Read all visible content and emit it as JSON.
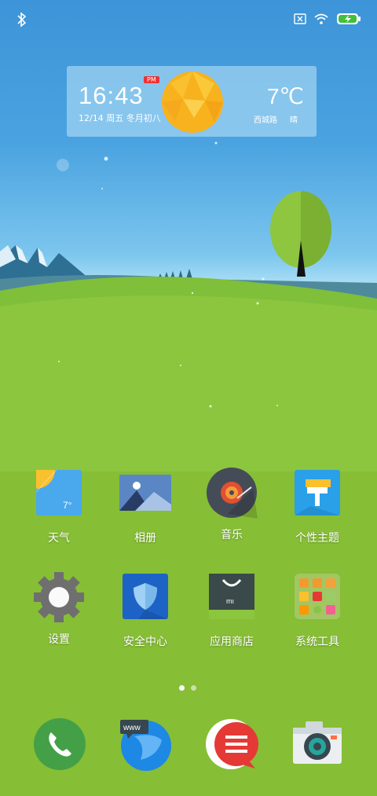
{
  "status": {
    "icons": [
      "bluetooth-icon",
      "sim-off-icon",
      "wifi-icon",
      "battery-charging-icon"
    ]
  },
  "widget": {
    "time": "16:43",
    "ampm": "PM",
    "date": "12/14 周五 冬月初八",
    "temperature": "7℃",
    "location": "西城路",
    "condition": "晴"
  },
  "apps": [
    {
      "label": "天气",
      "icon": "weather-icon",
      "badge": "7°"
    },
    {
      "label": "相册",
      "icon": "gallery-icon"
    },
    {
      "label": "音乐",
      "icon": "music-icon"
    },
    {
      "label": "个性主题",
      "icon": "themes-icon"
    },
    {
      "label": "设置",
      "icon": "settings-icon"
    },
    {
      "label": "安全中心",
      "icon": "security-icon"
    },
    {
      "label": "应用商店",
      "icon": "app-store-icon"
    },
    {
      "label": "系统工具",
      "icon": "tools-folder-icon"
    }
  ],
  "dock": [
    {
      "icon": "phone-icon"
    },
    {
      "icon": "browser-icon",
      "text": "www"
    },
    {
      "icon": "messages-icon"
    },
    {
      "icon": "camera-icon"
    }
  ],
  "page_indicator": {
    "pages": 2,
    "current": 1
  }
}
